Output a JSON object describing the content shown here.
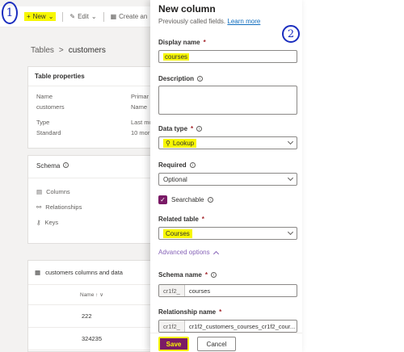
{
  "app": {
    "commands": {
      "new_label": "New",
      "edit_label": "Edit",
      "create_label": "Create an"
    },
    "annotations": {
      "first": "1",
      "second": "2"
    },
    "breadcrumb": {
      "root": "Tables",
      "separator": ">",
      "current": "customers"
    },
    "table_properties": {
      "title": "Table properties",
      "rows": [
        [
          "Name",
          "Primar"
        ],
        [
          "customers",
          "Name"
        ],
        [
          "Type",
          "Last mo"
        ],
        [
          "Standard",
          "10 mor"
        ]
      ]
    },
    "schema": {
      "title": "Schema",
      "items": [
        "Columns",
        "Relationships",
        "Keys"
      ]
    },
    "columns_card": {
      "title": "customers columns and data",
      "header": "Name ↑ ∨",
      "rows": [
        "222",
        "324235"
      ]
    }
  },
  "panel": {
    "title": "New column",
    "subtitle": "Previously called fields.",
    "learn_more": "Learn more",
    "display_name": {
      "label": "Display name",
      "required": "*",
      "value": "courses"
    },
    "description": {
      "label": "Description",
      "value": ""
    },
    "data_type": {
      "label": "Data type",
      "required": "*",
      "value": "Lookup"
    },
    "required": {
      "label": "Required",
      "value": "Optional"
    },
    "searchable": {
      "label": "Searchable",
      "checked": true
    },
    "related_table": {
      "label": "Related table",
      "required": "*",
      "value": "Courses"
    },
    "advanced_options": "Advanced options",
    "schema_name": {
      "label": "Schema name",
      "required": "*",
      "prefix": "cr1f2_",
      "value": "courses"
    },
    "relationship_name": {
      "label": "Relationship name",
      "required": "*",
      "prefix": "cr1f2_",
      "value": "cr1f2_customers_courses_cr1f2_cour..."
    },
    "footer": {
      "save": "Save",
      "cancel": "Cancel"
    }
  },
  "colors": {
    "accent": "#7a1a66",
    "highlight": "#f7f700",
    "annotation": "#1a2dbf",
    "link": "#0f6cbd"
  }
}
